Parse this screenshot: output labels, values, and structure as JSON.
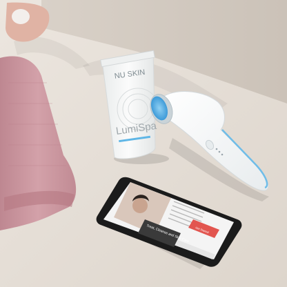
{
  "photo": {
    "tube": {
      "brand": "NU SKIN",
      "product": "LumiSpa"
    },
    "phone": {
      "headline": "Treat, Cleanse and Skin Care",
      "button": "Get Started"
    }
  },
  "colors": {
    "floor": "#e4ddd5",
    "wall": "#cfc6bc",
    "towel": "#c9929b",
    "device": "#f6f6f6",
    "device_accent": "#4ea9e2",
    "phone_body": "#1b1b1b",
    "app_accent": "#e2554f"
  }
}
